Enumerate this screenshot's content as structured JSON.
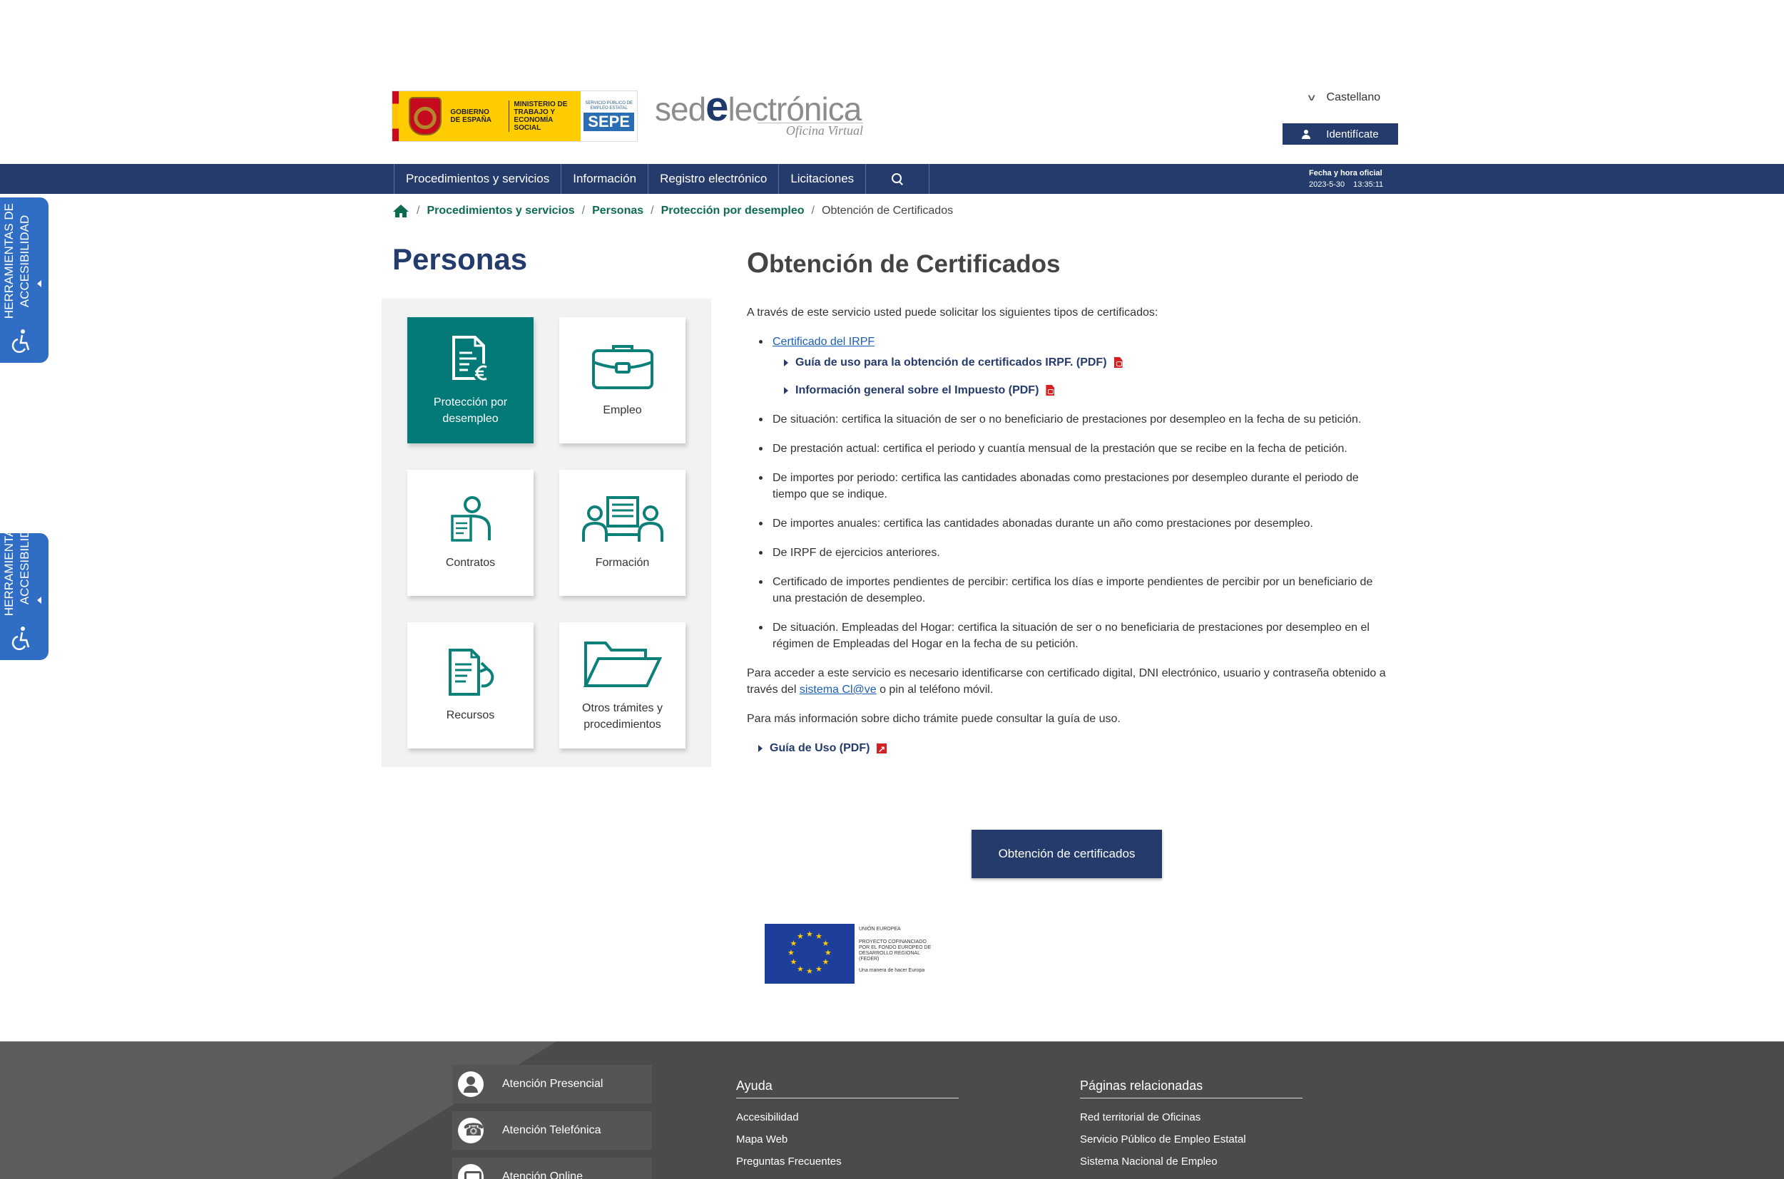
{
  "header": {
    "gov_logo": {
      "gobierno": "GOBIERNO DE ESPAÑA",
      "ministerio": "MINISTERIO DE TRABAJO Y ECONOMÍA SOCIAL",
      "sepe_small": "SERVICIO PÚBLICO DE EMPLEO ESTATAL",
      "sepe": "SEPE"
    },
    "sede_logo": {
      "pre": "sed",
      "e": "e",
      "post": "lectrónica",
      "sub": "Oficina Virtual"
    },
    "language": "Castellano",
    "identify_label": "Identifícate"
  },
  "nav": {
    "items": [
      {
        "label": "Procedimientos y servicios"
      },
      {
        "label": "Información"
      },
      {
        "label": "Registro electrónico"
      },
      {
        "label": "Licitaciones"
      }
    ],
    "official_time": {
      "title": "Fecha y hora oficial",
      "date": "2023-5-30",
      "time": "13:35:11"
    }
  },
  "accessibility": {
    "line1": "HERRAMIENTAS DE",
    "line2": "ACCESIBILIDAD"
  },
  "breadcrumb": {
    "items": [
      {
        "label": "Procedimientos y servicios"
      },
      {
        "label": "Personas"
      },
      {
        "label": "Protección por desempleo"
      }
    ],
    "current": "Obtención de Certificados",
    "separator": "/"
  },
  "left": {
    "title": "Personas",
    "cards": [
      {
        "label": "Protección por desempleo",
        "icon": "document-euro-icon",
        "active": true
      },
      {
        "label": "Empleo",
        "icon": "briefcase-icon",
        "active": false
      },
      {
        "label": "Contratos",
        "icon": "contract-person-icon",
        "active": false
      },
      {
        "label": "Formación",
        "icon": "training-icon",
        "active": false
      },
      {
        "label": "Recursos",
        "icon": "appeal-document-icon",
        "active": false
      },
      {
        "label": "Otros trámites y procedimientos",
        "icon": "folder-icon",
        "active": false
      }
    ]
  },
  "main": {
    "title_first": "O",
    "title_rest": "btención de Certificados",
    "intro": "A través de este servicio usted puede solicitar los siguientes tipos de certificados:",
    "irpf_link": "Certificado del IRPF",
    "irpf_sublinks": [
      {
        "label": "Guía de uso para la obtención de certificados IRPF. (PDF)"
      },
      {
        "label": "Información general sobre el Impuesto (PDF)"
      }
    ],
    "bullets": [
      "De situación: certifica la situación de ser o no beneficiario de prestaciones por desempleo en la fecha de su petición.",
      "De prestación actual: certifica el periodo y cuantía mensual de la prestación que se recibe en la fecha de petición.",
      "De importes por periodo: certifica las cantidades abonadas como prestaciones por desempleo durante el periodo de tiempo que se indique.",
      "De importes anuales: certifica las cantidades abonadas durante un año como prestaciones por desempleo.",
      "De IRPF de ejercicios anteriores.",
      "Certificado de importes pendientes de percibir: certifica los días e importe pendientes de percibir por un beneficiario de una prestación de desempleo.",
      "De situación. Empleadas del Hogar: certifica la situación de ser o no beneficiaria de prestaciones por desempleo en el régimen de Empleadas del Hogar en la fecha de su petición."
    ],
    "access_text_1": "Para acceder a este servicio es necesario identificarse con certificado digital, DNI electrónico, usuario y contraseña obtenido a través del ",
    "access_link": "sistema Cl@ve",
    "access_text_2": " o pin al teléfono móvil.",
    "more_info": "Para más información sobre dicho trámite puede consultar la guía de uso.",
    "guide_link": "Guía de Uso (PDF)",
    "cta_label": "Obtención de certificados",
    "eu": {
      "line1": "UNIÓN EUROPEA",
      "line2": "PROYECTO COFINANCIADO POR EL FONDO EUROPEO DE DESARROLLO REGIONAL (FEDER)",
      "line3": "Una manera de hacer Europa"
    }
  },
  "footer": {
    "contacts": [
      {
        "label": "Atención Presencial",
        "icon": "user-icon"
      },
      {
        "label": "Atención Telefónica",
        "icon": "phone-icon"
      },
      {
        "label": "Atención Online",
        "icon": "chat-icon"
      }
    ],
    "help": {
      "title": "Ayuda",
      "links": [
        "Accesibilidad",
        "Mapa Web",
        "Preguntas Frecuentes"
      ]
    },
    "related": {
      "title": "Páginas relacionadas",
      "links": [
        "Red territorial de Oficinas",
        "Servicio Público de Empleo Estatal",
        "Sistema Nacional de Empleo"
      ]
    }
  },
  "colors": {
    "primary": "#243b6b",
    "accent_green": "#047a78",
    "breadcrumb_link": "#0d6b50",
    "link": "#1a5fb4",
    "accessibility_tab": "#2f6ec4",
    "footer": "#5c5c5c"
  }
}
